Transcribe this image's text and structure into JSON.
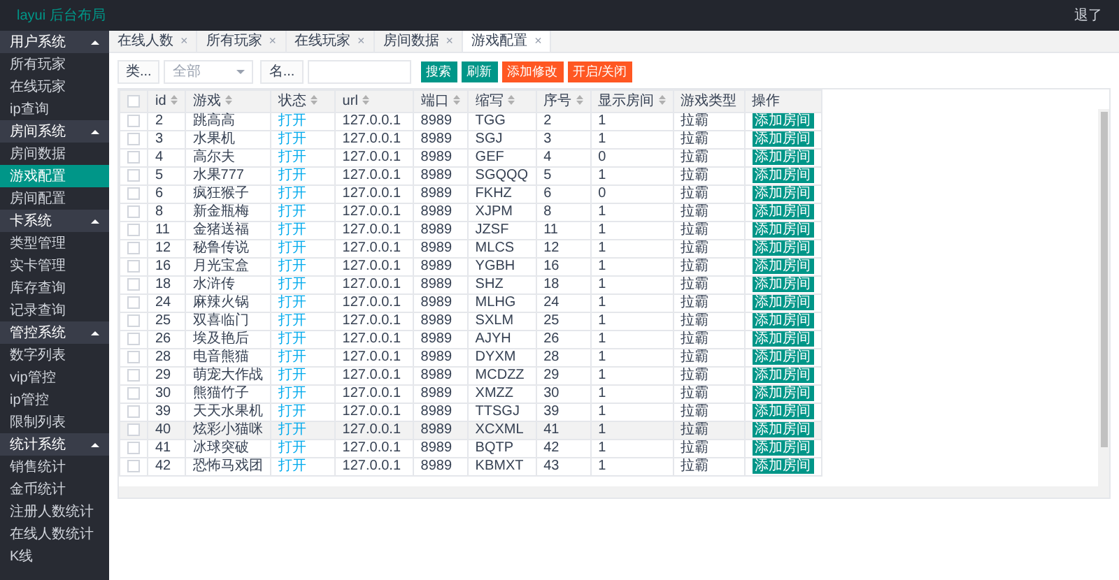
{
  "header": {
    "logo": "layui 后台布局",
    "user": "退了"
  },
  "sidebar": {
    "groups": [
      {
        "title": "用户系统",
        "expanded": true,
        "items": [
          {
            "label": "所有玩家",
            "selected": false
          },
          {
            "label": "在线玩家",
            "selected": false
          },
          {
            "label": "ip查询",
            "selected": false
          }
        ]
      },
      {
        "title": "房间系统",
        "expanded": true,
        "items": [
          {
            "label": "房间数据",
            "selected": false
          },
          {
            "label": "游戏配置",
            "selected": true
          },
          {
            "label": "房间配置",
            "selected": false
          }
        ]
      },
      {
        "title": "卡系统",
        "expanded": true,
        "items": [
          {
            "label": "类型管理",
            "selected": false
          },
          {
            "label": "实卡管理",
            "selected": false
          },
          {
            "label": "库存查询",
            "selected": false
          },
          {
            "label": "记录查询",
            "selected": false
          }
        ]
      },
      {
        "title": "管控系统",
        "expanded": true,
        "items": [
          {
            "label": "数字列表",
            "selected": false
          },
          {
            "label": "vip管控",
            "selected": false
          },
          {
            "label": "ip管控",
            "selected": false
          },
          {
            "label": "限制列表",
            "selected": false
          }
        ]
      },
      {
        "title": "统计系统",
        "expanded": true,
        "items": [
          {
            "label": "销售统计",
            "selected": false
          },
          {
            "label": "金币统计",
            "selected": false
          },
          {
            "label": "注册人数统计",
            "selected": false
          },
          {
            "label": "在线人数统计",
            "selected": false
          },
          {
            "label": "K线",
            "selected": false
          }
        ]
      }
    ]
  },
  "tabs": [
    {
      "label": "在线人数",
      "selected": false,
      "close": "×"
    },
    {
      "label": "所有玩家",
      "selected": false,
      "close": "×"
    },
    {
      "label": "在线玩家",
      "selected": false,
      "close": "×"
    },
    {
      "label": "房间数据",
      "selected": false,
      "close": "×"
    },
    {
      "label": "游戏配置",
      "selected": true,
      "close": "×"
    }
  ],
  "toolbar": {
    "type_label": "类...",
    "type_value": "全部",
    "name_label": "名...",
    "buttons": [
      {
        "label": "搜索",
        "kind": "primary"
      },
      {
        "label": "刷新",
        "kind": "primary"
      },
      {
        "label": "添加修改",
        "kind": "warning"
      },
      {
        "label": "开启/关闭",
        "kind": "warning"
      }
    ]
  },
  "table": {
    "header_checked": false,
    "columns": [
      {
        "label": "id",
        "kind": "text",
        "sortable": true
      },
      {
        "label": "游戏",
        "kind": "text",
        "sortable": true
      },
      {
        "label": "状态",
        "kind": "link",
        "sortable": true
      },
      {
        "label": "url",
        "kind": "text",
        "sortable": true
      },
      {
        "label": "端口",
        "kind": "text",
        "sortable": true
      },
      {
        "label": "缩写",
        "kind": "text",
        "sortable": true
      },
      {
        "label": "序号",
        "kind": "text",
        "sortable": true
      },
      {
        "label": "显示房间",
        "kind": "text",
        "sortable": true
      },
      {
        "label": "游戏类型",
        "kind": "text",
        "sortable": false
      },
      {
        "label": "操作",
        "kind": "button",
        "sortable": false
      }
    ],
    "rows": [
      {
        "checked": false,
        "highlighted": false,
        "cells": [
          "2",
          "跳高高",
          "打开",
          "127.0.0.1",
          "8989",
          "TGG",
          "2",
          "1",
          "拉霸",
          "添加房间"
        ]
      },
      {
        "checked": false,
        "highlighted": false,
        "cells": [
          "3",
          "水果机",
          "打开",
          "127.0.0.1",
          "8989",
          "SGJ",
          "3",
          "1",
          "拉霸",
          "添加房间"
        ]
      },
      {
        "checked": false,
        "highlighted": false,
        "cells": [
          "4",
          "高尔夫",
          "打开",
          "127.0.0.1",
          "8989",
          "GEF",
          "4",
          "0",
          "拉霸",
          "添加房间"
        ]
      },
      {
        "checked": false,
        "highlighted": false,
        "cells": [
          "5",
          "水果777",
          "打开",
          "127.0.0.1",
          "8989",
          "SGQQQ",
          "5",
          "1",
          "拉霸",
          "添加房间"
        ]
      },
      {
        "checked": false,
        "highlighted": false,
        "cells": [
          "6",
          "疯狂猴子",
          "打开",
          "127.0.0.1",
          "8989",
          "FKHZ",
          "6",
          "0",
          "拉霸",
          "添加房间"
        ]
      },
      {
        "checked": false,
        "highlighted": false,
        "cells": [
          "8",
          "新金瓶梅",
          "打开",
          "127.0.0.1",
          "8989",
          "XJPM",
          "8",
          "1",
          "拉霸",
          "添加房间"
        ]
      },
      {
        "checked": false,
        "highlighted": false,
        "cells": [
          "11",
          "金猪送福",
          "打开",
          "127.0.0.1",
          "8989",
          "JZSF",
          "11",
          "1",
          "拉霸",
          "添加房间"
        ]
      },
      {
        "checked": false,
        "highlighted": false,
        "cells": [
          "12",
          "秘鲁传说",
          "打开",
          "127.0.0.1",
          "8989",
          "MLCS",
          "12",
          "1",
          "拉霸",
          "添加房间"
        ]
      },
      {
        "checked": false,
        "highlighted": false,
        "cells": [
          "16",
          "月光宝盒",
          "打开",
          "127.0.0.1",
          "8989",
          "YGBH",
          "16",
          "1",
          "拉霸",
          "添加房间"
        ]
      },
      {
        "checked": false,
        "highlighted": false,
        "cells": [
          "18",
          "水浒传",
          "打开",
          "127.0.0.1",
          "8989",
          "SHZ",
          "18",
          "1",
          "拉霸",
          "添加房间"
        ]
      },
      {
        "checked": false,
        "highlighted": false,
        "cells": [
          "24",
          "麻辣火锅",
          "打开",
          "127.0.0.1",
          "8989",
          "MLHG",
          "24",
          "1",
          "拉霸",
          "添加房间"
        ]
      },
      {
        "checked": false,
        "highlighted": false,
        "cells": [
          "25",
          "双喜临门",
          "打开",
          "127.0.0.1",
          "8989",
          "SXLM",
          "25",
          "1",
          "拉霸",
          "添加房间"
        ]
      },
      {
        "checked": false,
        "highlighted": false,
        "cells": [
          "26",
          "埃及艳后",
          "打开",
          "127.0.0.1",
          "8989",
          "AJYH",
          "26",
          "1",
          "拉霸",
          "添加房间"
        ]
      },
      {
        "checked": false,
        "highlighted": false,
        "cells": [
          "28",
          "电音熊猫",
          "打开",
          "127.0.0.1",
          "8989",
          "DYXM",
          "28",
          "1",
          "拉霸",
          "添加房间"
        ]
      },
      {
        "checked": false,
        "highlighted": false,
        "cells": [
          "29",
          "萌宠大作战",
          "打开",
          "127.0.0.1",
          "8989",
          "MCDZZ",
          "29",
          "1",
          "拉霸",
          "添加房间"
        ]
      },
      {
        "checked": false,
        "highlighted": false,
        "cells": [
          "30",
          "熊猫竹子",
          "打开",
          "127.0.0.1",
          "8989",
          "XMZZ",
          "30",
          "1",
          "拉霸",
          "添加房间"
        ]
      },
      {
        "checked": false,
        "highlighted": false,
        "cells": [
          "39",
          "天天水果机",
          "打开",
          "127.0.0.1",
          "8989",
          "TTSGJ",
          "39",
          "1",
          "拉霸",
          "添加房间"
        ]
      },
      {
        "checked": false,
        "highlighted": true,
        "cells": [
          "40",
          "炫彩小猫咪",
          "打开",
          "127.0.0.1",
          "8989",
          "XCXML",
          "41",
          "1",
          "拉霸",
          "添加房间"
        ]
      },
      {
        "checked": false,
        "highlighted": false,
        "cells": [
          "41",
          "冰球突破",
          "打开",
          "127.0.0.1",
          "8989",
          "BQTP",
          "42",
          "1",
          "拉霸",
          "添加房间"
        ]
      },
      {
        "checked": false,
        "highlighted": false,
        "cells": [
          "42",
          "恐怖马戏团",
          "打开",
          "127.0.0.1",
          "8989",
          "KBMXT",
          "43",
          "1",
          "拉霸",
          "添加房间"
        ]
      }
    ]
  }
}
